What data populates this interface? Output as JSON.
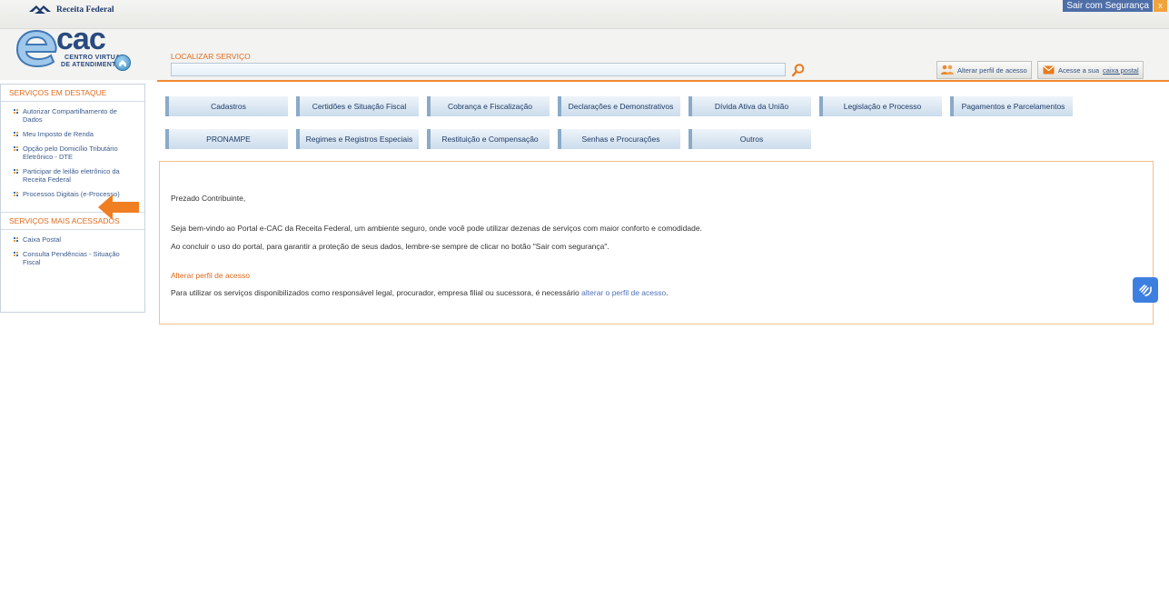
{
  "header": {
    "brand": "Receita Federal",
    "logout_label": "Sair com Segurança",
    "logout_close": "x",
    "logo_main": "cac",
    "logo_sub1": "CENTRO VIRTUAL",
    "logo_sub2": "DE ATENDIMENTO"
  },
  "search": {
    "label": "LOCALIZAR SERVIÇO",
    "value": "",
    "placeholder": ""
  },
  "actions": {
    "perfil": "Alterar perfil de acesso",
    "caixa_prefix": "Acesse a sua",
    "caixa_link": "caixa postal"
  },
  "sidebar": {
    "destaque_title": "SERVIÇOS EM DESTAQUE",
    "destaque": [
      "Autorizar Compartilhamento de Dados",
      "Meu Imposto de Renda",
      "Opção pelo Domicílio Tributário Eletrônico - DTE",
      "Participar de leilão eletrônico da Receita Federal",
      "Processos Digitais (e-Processo)"
    ],
    "acessados_title": "SERVIÇOS MAIS ACESSADOS",
    "acessados": [
      "Caixa Postal",
      "Consulta Pendências - Situação Fiscal"
    ]
  },
  "categories": {
    "row1": [
      "Cadastros",
      "Certidões e Situação Fiscal",
      "Cobrança e Fiscalização",
      "Declarações e Demonstrativos",
      "Dívida Ativa da União",
      "Legislação e Processo",
      "Pagamentos e Parcelamentos"
    ],
    "row2": [
      "PRONAMPE",
      "Regimes e Registros Especiais",
      "Restituição e Compensação",
      "Senhas e Procurações",
      "Outros"
    ]
  },
  "welcome": {
    "greeting": "Prezado Contribuinte,",
    "line1": "Seja bem-vindo ao Portal e-CAC da Receita Federal, um ambiente seguro, onde você pode utilizar dezenas de serviços com maior conforto e comodidade.",
    "line2": "Ao concluir o uso do portal, para garantir a proteção de seus dados, lembre-se sempre de clicar no botão \"Sair com segurança\".",
    "alt_title": "Alterar perfil de acesso",
    "line3_prefix": "Para utilizar os serviços disponibilizados como responsável legal, procurador, empresa filial ou sucessora, é necessário",
    "line3_link": "alterar o perfil de acesso",
    "line3_suffix": "."
  },
  "colors": {
    "accent_orange": "#f08a33",
    "link_blue": "#4f72b5",
    "nav_blue": "#1f3b66"
  }
}
